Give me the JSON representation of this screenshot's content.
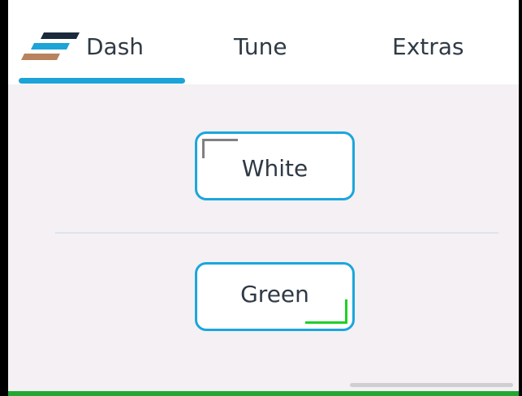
{
  "tabs": [
    {
      "label": "Dash",
      "icon": "stripes-logo-icon",
      "selected": true
    },
    {
      "label": "Tune",
      "selected": false
    },
    {
      "label": "Extras",
      "selected": false
    }
  ],
  "buttons": {
    "white": {
      "label": "White"
    },
    "green": {
      "label": "Green"
    }
  },
  "colors": {
    "accent": "#1ba6dc",
    "tab_indicator": "#1ca3d8",
    "content_background": "#f4f0f4",
    "text": "#2f3a45",
    "white_marker": "#808080",
    "green_marker": "#1fcf28",
    "bottom_bar": "#22a832",
    "logo_stripes": [
      "#1a2a3a",
      "#1ca3d8",
      "#b8835e"
    ]
  }
}
